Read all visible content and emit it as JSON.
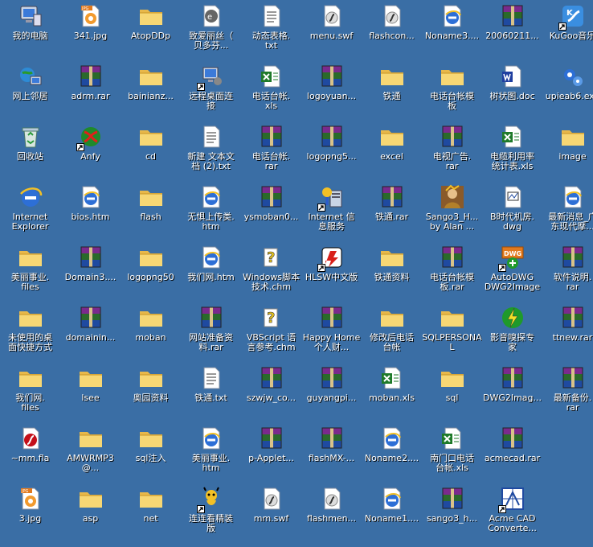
{
  "desktop": {
    "icons": [
      {
        "label": "我的电脑",
        "type": "mycomputer",
        "shortcut": false
      },
      {
        "label": "网上邻居",
        "type": "network",
        "shortcut": false
      },
      {
        "label": "回收站",
        "type": "recycle",
        "shortcut": false
      },
      {
        "label": "Internet\nExplorer",
        "type": "ie",
        "shortcut": false
      },
      {
        "label": "美丽事业.\nfiles",
        "type": "folder",
        "shortcut": false
      },
      {
        "label": "未使用的桌\n面快捷方式",
        "type": "folder",
        "shortcut": false
      },
      {
        "label": "我们网.\nfiles",
        "type": "folder",
        "shortcut": false
      },
      {
        "label": "~mm.fla",
        "type": "flash",
        "shortcut": false
      },
      {
        "label": "3.jpg",
        "type": "jpg",
        "shortcut": false
      },
      {
        "label": "341.jpg",
        "type": "jpg",
        "shortcut": false
      },
      {
        "label": "adrm.rar",
        "type": "rar",
        "shortcut": false
      },
      {
        "label": "Anfy",
        "type": "anfy",
        "shortcut": true
      },
      {
        "label": "bios.htm",
        "type": "htm",
        "shortcut": false
      },
      {
        "label": "Domain3....",
        "type": "rar",
        "shortcut": false
      },
      {
        "label": "domainin...",
        "type": "rar",
        "shortcut": false
      },
      {
        "label": "lsee",
        "type": "folder",
        "shortcut": false
      },
      {
        "label": "AMWRMP3@...",
        "type": "folder",
        "shortcut": false
      },
      {
        "label": "asp",
        "type": "folder",
        "shortcut": false
      },
      {
        "label": "AtopDDp",
        "type": "folder",
        "shortcut": false
      },
      {
        "label": "bainianz...",
        "type": "folder",
        "shortcut": false
      },
      {
        "label": "cd",
        "type": "folder",
        "shortcut": false
      },
      {
        "label": "flash",
        "type": "folder",
        "shortcut": false
      },
      {
        "label": "logopng50",
        "type": "folder",
        "shortcut": false
      },
      {
        "label": "moban",
        "type": "folder",
        "shortcut": false
      },
      {
        "label": "奥园资料",
        "type": "folder",
        "shortcut": false
      },
      {
        "label": "sql注入",
        "type": "folder",
        "shortcut": false
      },
      {
        "label": "net",
        "type": "folder",
        "shortcut": false
      },
      {
        "label": "致爱丽丝（\n贝多芬...",
        "type": "audio",
        "shortcut": false
      },
      {
        "label": "远程桌面连\n接",
        "type": "remote",
        "shortcut": true
      },
      {
        "label": "新建 文本文\n档 (2).txt",
        "type": "txt",
        "shortcut": false
      },
      {
        "label": "无惧上传类.\nhtm",
        "type": "htm",
        "shortcut": false
      },
      {
        "label": "我们网.htm",
        "type": "htm",
        "shortcut": false
      },
      {
        "label": "网站准备资\n料.rar",
        "type": "rar",
        "shortcut": false
      },
      {
        "label": "铁通.txt",
        "type": "txt",
        "shortcut": false
      },
      {
        "label": "美丽事业.\nhtm",
        "type": "htm",
        "shortcut": false
      },
      {
        "label": "连连看精装\n版",
        "type": "game",
        "shortcut": true
      },
      {
        "label": "动态表格.\ntxt",
        "type": "txt",
        "shortcut": false
      },
      {
        "label": "电话台帐.\nxls",
        "type": "xls",
        "shortcut": false
      },
      {
        "label": "电话台帐.\nrar",
        "type": "rar",
        "shortcut": false
      },
      {
        "label": "ysmoban0...",
        "type": "rar",
        "shortcut": false
      },
      {
        "label": "Windows脚本\n技术.chm",
        "type": "chm",
        "shortcut": false
      },
      {
        "label": "VBScript 语\n言参考.chm",
        "type": "chm",
        "shortcut": false
      },
      {
        "label": "szwjw_co...",
        "type": "rar",
        "shortcut": false
      },
      {
        "label": "p-Applet...",
        "type": "rar",
        "shortcut": false
      },
      {
        "label": "mm.swf",
        "type": "swf",
        "shortcut": false
      },
      {
        "label": "menu.swf",
        "type": "swf",
        "shortcut": false
      },
      {
        "label": "logoyuan...",
        "type": "rar",
        "shortcut": false
      },
      {
        "label": "logopng5...",
        "type": "rar",
        "shortcut": false
      },
      {
        "label": "Internet 信\n息服务",
        "type": "iis",
        "shortcut": true
      },
      {
        "label": "HLSW中文版",
        "type": "hlsw",
        "shortcut": true
      },
      {
        "label": "Happy Home\n个人财...",
        "type": "rar",
        "shortcut": false
      },
      {
        "label": "guyangpi...",
        "type": "rar",
        "shortcut": false
      },
      {
        "label": "flashMX-...",
        "type": "rar",
        "shortcut": false
      },
      {
        "label": "flashmen...",
        "type": "swf",
        "shortcut": false
      },
      {
        "label": "flashcon...",
        "type": "swf",
        "shortcut": false
      },
      {
        "label": "铁通",
        "type": "folder",
        "shortcut": false
      },
      {
        "label": "excel",
        "type": "folder",
        "shortcut": false
      },
      {
        "label": "铁通.rar",
        "type": "rar",
        "shortcut": false
      },
      {
        "label": "铁通资料",
        "type": "folder",
        "shortcut": false
      },
      {
        "label": "修改后电话\n台帐",
        "type": "folder",
        "shortcut": false
      },
      {
        "label": "moban.xls",
        "type": "xls",
        "shortcut": false
      },
      {
        "label": "Noname2....",
        "type": "htm",
        "shortcut": false
      },
      {
        "label": "Noname1....",
        "type": "htm",
        "shortcut": false
      },
      {
        "label": "Noname3....",
        "type": "htm",
        "shortcut": false
      },
      {
        "label": "电话台帐模\n板",
        "type": "folder",
        "shortcut": false
      },
      {
        "label": "电视广告.\nrar",
        "type": "rar",
        "shortcut": false
      },
      {
        "label": "Sango3_H...\nby Alan ...",
        "type": "sango",
        "shortcut": false
      },
      {
        "label": "电话台帐模\n板.rar",
        "type": "rar",
        "shortcut": false
      },
      {
        "label": "SQLPERSONAL",
        "type": "folder",
        "shortcut": false
      },
      {
        "label": "sql",
        "type": "folder",
        "shortcut": false
      },
      {
        "label": "南门口电话\n台帐.xls",
        "type": "xls",
        "shortcut": false
      },
      {
        "label": "sango3_h...",
        "type": "rar",
        "shortcut": false
      },
      {
        "label": "20060211...",
        "type": "rar",
        "shortcut": false
      },
      {
        "label": "树状图.doc",
        "type": "doc",
        "shortcut": false
      },
      {
        "label": "电缆利用率\n统计表.xls",
        "type": "xls",
        "shortcut": false
      },
      {
        "label": "B时代机房.\ndwg",
        "type": "dwg",
        "shortcut": false
      },
      {
        "label": "AutoDWG\nDWG2Image",
        "type": "autodwg",
        "shortcut": true
      },
      {
        "label": "影音嗅探专\n家",
        "type": "sniffer",
        "shortcut": false
      },
      {
        "label": "DWG2Imag...",
        "type": "rar",
        "shortcut": false
      },
      {
        "label": "acmecad.rar",
        "type": "rar",
        "shortcut": false
      },
      {
        "label": "Acme CAD\nConverte...",
        "type": "acme",
        "shortcut": true
      },
      {
        "label": "KuGoo音乐",
        "type": "kugoo",
        "shortcut": true
      },
      {
        "label": "upieab6.exe",
        "type": "setup",
        "shortcut": false
      },
      {
        "label": "image",
        "type": "folder",
        "shortcut": false
      },
      {
        "label": "最新消息_广\n东现代摩...",
        "type": "htm",
        "shortcut": false
      },
      {
        "label": "软件说明.\nrar",
        "type": "rar",
        "shortcut": false
      },
      {
        "label": "ttnew.rar",
        "type": "rar",
        "shortcut": false
      },
      {
        "label": "最新备份.\nrar",
        "type": "rar",
        "shortcut": false
      }
    ]
  }
}
